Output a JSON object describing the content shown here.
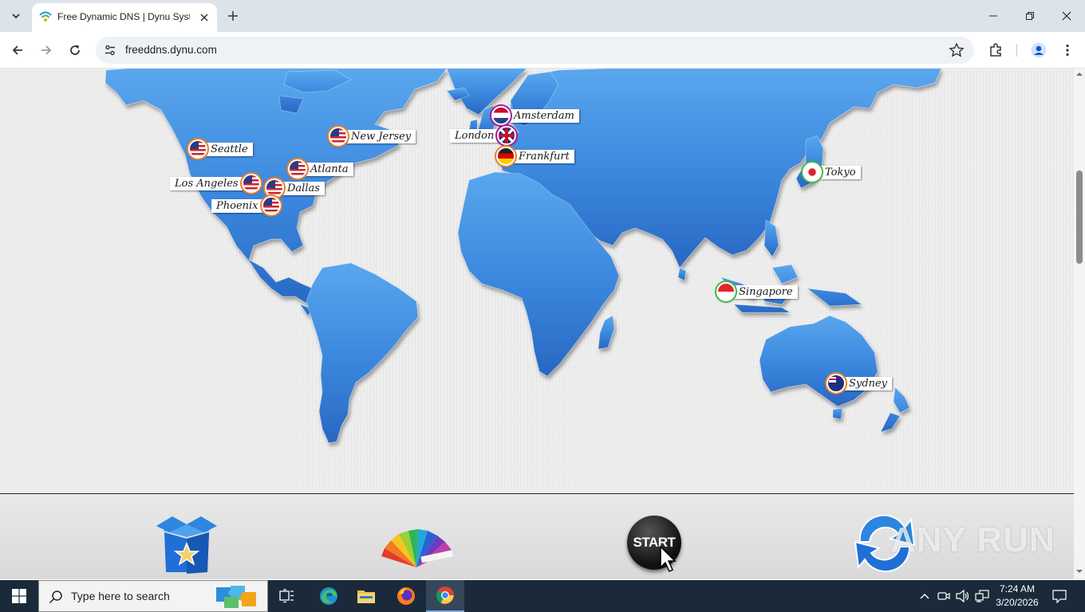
{
  "browser": {
    "tab_title": "Free Dynamic DNS | Dynu Syste",
    "url": "freeddns.dynu.com"
  },
  "map": {
    "locations": [
      {
        "name": "Seattle",
        "flag": "us"
      },
      {
        "name": "New Jersey",
        "flag": "us"
      },
      {
        "name": "Atlanta",
        "flag": "us"
      },
      {
        "name": "Los Angeles",
        "flag": "us"
      },
      {
        "name": "Dallas",
        "flag": "us"
      },
      {
        "name": "Phoenix",
        "flag": "us"
      },
      {
        "name": "Amsterdam",
        "flag": "nl"
      },
      {
        "name": "London",
        "flag": "uk"
      },
      {
        "name": "Frankfurt",
        "flag": "de"
      },
      {
        "name": "Tokyo",
        "flag": "jp"
      },
      {
        "name": "Singapore",
        "flag": "sg"
      },
      {
        "name": "Sydney",
        "flag": "au"
      }
    ],
    "ocean_color": "#e9e9e9",
    "land_color": "#2f78d3"
  },
  "features": {
    "start_label": "START"
  },
  "taskbar": {
    "search_placeholder": "Type here to search",
    "time": "7:24 AM",
    "date": "3/20/2026"
  },
  "watermark": "ANY RUN"
}
